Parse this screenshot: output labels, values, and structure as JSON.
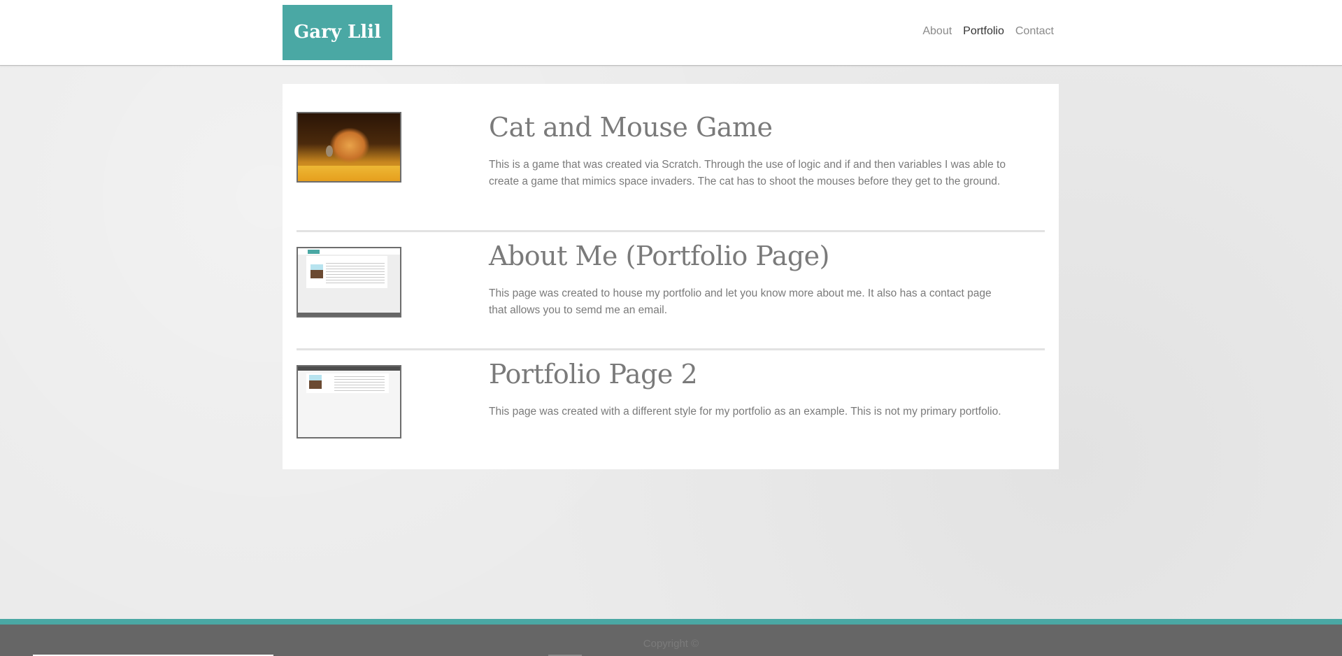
{
  "header": {
    "logo_text": "Gary Llil",
    "nav": [
      {
        "label": "About",
        "active": false
      },
      {
        "label": "Portfolio",
        "active": true
      },
      {
        "label": "Contact",
        "active": false
      }
    ]
  },
  "projects": [
    {
      "title": "Cat and Mouse Game",
      "description": "This is a game that was created via Scratch. Through the use of logic and if and then variables I was able to create a game that mimics space invaders. The cat has to shoot the mouses before they get to the ground.",
      "thumbnail": "cat-mouse-game-thumbnail"
    },
    {
      "title": "About Me (Portfolio Page)",
      "description": "This page was created to house my portfolio and let you know more about me. It also has a contact page that allows you to semd me an email.",
      "thumbnail": "about-me-page-thumbnail"
    },
    {
      "title": "Portfolio Page 2",
      "description": "This page was created with a different style for my portfolio as an example. This is not my primary portfolio.",
      "thumbnail": "portfolio-page-2-thumbnail"
    }
  ],
  "footer": {
    "copyright": "Copyright ©"
  },
  "colors": {
    "accent": "#4aa8a4",
    "footer_bg": "#666666",
    "text": "#7a7a7a",
    "nav_active": "#333333"
  }
}
